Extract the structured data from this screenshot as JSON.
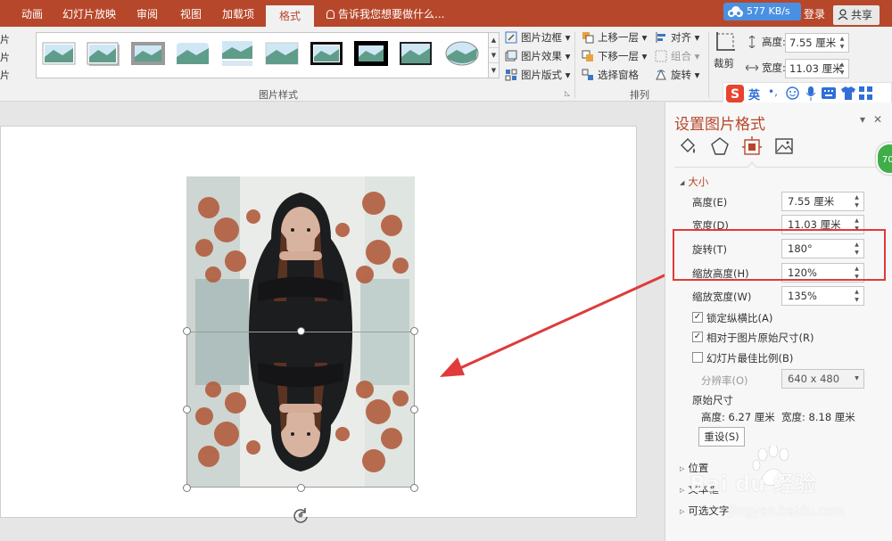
{
  "tabs": [
    "动画",
    "幻灯片放映",
    "审阅",
    "视图",
    "加载项",
    "格式"
  ],
  "active_tab": "格式",
  "tell_me": "告诉我您想要做什么...",
  "network_speed": "577 KB/s",
  "login": "登录",
  "share": "共享",
  "left_fragments": [
    "片",
    "片",
    "片"
  ],
  "gallery_group_label": "图片样式",
  "picture_commands": {
    "border": "图片边框",
    "effects": "图片效果",
    "layout": "图片版式"
  },
  "arrange_group_label": "排列",
  "arrange_commands": {
    "bring_forward": "上移一层",
    "send_backward": "下移一层",
    "selection_pane": "选择窗格",
    "align": "对齐",
    "group": "组合",
    "rotate": "旋转"
  },
  "size_group": {
    "crop": "裁剪",
    "height_label": "高度:",
    "height_value": "7.55 厘米",
    "width_label": "宽度:",
    "width_value": "11.03 厘米"
  },
  "ime_label": "英",
  "pane": {
    "title": "设置图片格式",
    "section_size": "大小",
    "height_label": "高度(E)",
    "height_value": "7.55 厘米",
    "width_label": "宽度(D)",
    "width_value": "11.03 厘米",
    "rotation_label": "旋转(T)",
    "rotation_value": "180°",
    "scale_height_label": "缩放高度(H)",
    "scale_height_value": "120%",
    "scale_width_label": "缩放宽度(W)",
    "scale_width_value": "135%",
    "lock_aspect_label": "锁定纵横比(A)",
    "lock_aspect_checked": true,
    "relative_original_label": "相对于图片原始尺寸(R)",
    "relative_original_checked": true,
    "best_scale_label": "幻灯片最佳比例(B)",
    "best_scale_checked": false,
    "resolution_label": "分辨率(O)",
    "resolution_value": "640 x 480",
    "original_size_label": "原始尺寸",
    "original_height": "高度: 6.27 厘米",
    "original_width": "宽度: 8.18 厘米",
    "reset_label": "重设(S)",
    "section_position": "位置",
    "section_textbox": "文本框",
    "section_alt_text": "可选文字"
  },
  "badge_value": "70",
  "watermark": {
    "brand_text": "Bai  du 经验",
    "url": "jingyan.baidu.com"
  },
  "colors": {
    "accent": "#b7472a",
    "highlight": "#e03a3a",
    "arrow": "#e03a3a"
  }
}
